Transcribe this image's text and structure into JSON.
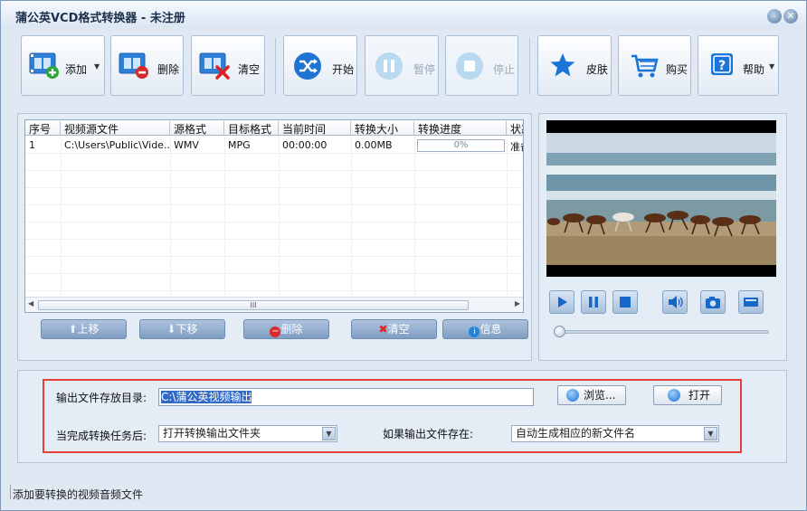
{
  "window": {
    "title": "蒲公英VCD格式转换器 - 未注册",
    "minimize_glyph": "–",
    "close_glyph": "✕"
  },
  "toolbar": [
    {
      "name": "add-button",
      "label": "添加",
      "icon": "film-add-icon",
      "disabled": false,
      "dropdown": true
    },
    {
      "name": "delete-button",
      "label": "删除",
      "icon": "film-remove-icon",
      "disabled": false,
      "dropdown": false
    },
    {
      "name": "clear-button",
      "label": "清空",
      "icon": "film-clear-icon",
      "disabled": false,
      "dropdown": false
    },
    {
      "name": "start-button",
      "label": "开始",
      "icon": "shuffle-icon",
      "disabled": false,
      "dropdown": false
    },
    {
      "name": "pause-button",
      "label": "暂停",
      "icon": "pause-icon",
      "disabled": true,
      "dropdown": false
    },
    {
      "name": "stop-button",
      "label": "停止",
      "icon": "stop-icon",
      "disabled": true,
      "dropdown": false
    },
    {
      "name": "skin-button",
      "label": "皮肤",
      "icon": "star-icon",
      "disabled": false,
      "dropdown": false
    },
    {
      "name": "buy-button",
      "label": "购买",
      "icon": "cart-icon",
      "disabled": false,
      "dropdown": false
    },
    {
      "name": "help-button",
      "label": "帮助",
      "icon": "help-icon",
      "disabled": false,
      "dropdown": true
    }
  ],
  "file_table": {
    "columns": [
      "序号",
      "视频源文件",
      "源格式",
      "目标格式",
      "当前时间",
      "转换大小",
      "转换进度",
      "状态"
    ],
    "rows": [
      {
        "index": "1",
        "source": "C:\\Users\\Public\\Vide...",
        "source_format": "WMV",
        "target_format": "MPG",
        "current_time": "00:00:00",
        "size": "0.00MB",
        "progress": "0%",
        "status": "准备"
      }
    ],
    "scroll_thumb_glyph": "III"
  },
  "list_buttons": {
    "move_up": "上移",
    "move_down": "下移",
    "delete": "删除",
    "clear": "清空",
    "info": "信息"
  },
  "player": {
    "controls": [
      "play-icon",
      "pause-icon",
      "stop-icon",
      "volume-icon",
      "snapshot-icon",
      "fullscreen-icon"
    ],
    "seek_position": 0
  },
  "output": {
    "dir_label": "输出文件存放目录:",
    "dir_value": "C:\\蒲公英视频输出",
    "browse_label": "浏览...",
    "open_label": "打开",
    "after_label": "当完成转换任务后:",
    "after_value": "打开转换输出文件夹",
    "exists_label": "如果输出文件存在:",
    "exists_value": "自动生成相应的新文件名"
  },
  "status_bar": {
    "text": "添加要转换的视频音频文件"
  },
  "colors": {
    "accent": "#1b6fd6",
    "highlight_border": "#e43d40",
    "selection": "#3169c6"
  }
}
